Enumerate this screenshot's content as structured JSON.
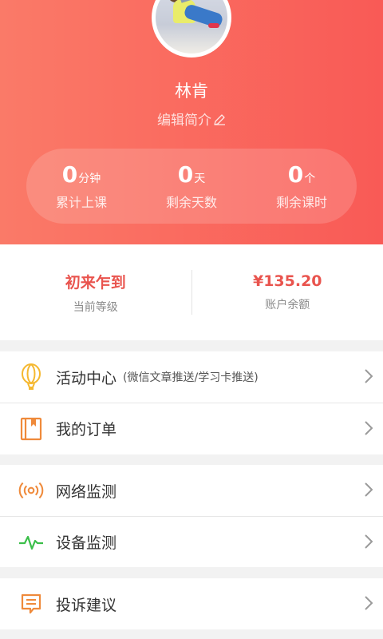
{
  "profile": {
    "name": "林肯",
    "intro_label": "编辑简介"
  },
  "stats": [
    {
      "value": "0",
      "unit": "分钟",
      "label": "累计上课"
    },
    {
      "value": "0",
      "unit": "天",
      "label": "剩余天数"
    },
    {
      "value": "0",
      "unit": "个",
      "label": "剩余课时"
    }
  ],
  "account": {
    "level_value": "初来乍到",
    "level_caption": "当前等级",
    "balance_value": "¥135.20",
    "balance_caption": "账户余额"
  },
  "menu": {
    "activity": {
      "label": "活动中心",
      "sub": "(微信文章推送/学习卡推送)",
      "icon": "balloon-icon",
      "color": "#f5b830"
    },
    "orders": {
      "label": "我的订单",
      "icon": "order-book-icon",
      "color": "#ef8a3b"
    },
    "network": {
      "label": "网络监测",
      "icon": "signal-icon",
      "color": "#ef8a3b"
    },
    "device": {
      "label": "设备监测",
      "icon": "pulse-icon",
      "color": "#3bbf4a"
    },
    "feedback": {
      "label": "投诉建议",
      "icon": "message-icon",
      "color": "#ef8a3b"
    }
  },
  "colors": {
    "header_start": "#fa7a68",
    "header_end": "#f95a56",
    "accent_red": "#e9544e"
  }
}
